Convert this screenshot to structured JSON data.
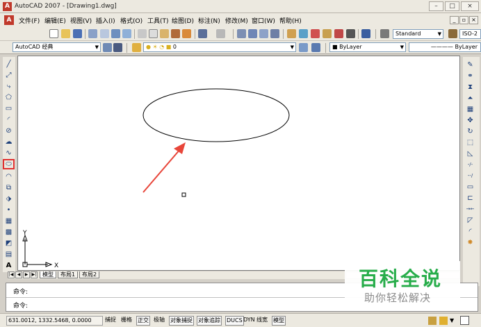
{
  "window": {
    "title": "AutoCAD 2007 - [Drawing1.dwg]",
    "app_icon": "A",
    "controls": {
      "minimize": "–",
      "maximize": "□",
      "close": "×"
    }
  },
  "menubar": {
    "doc_icon": "A",
    "items": [
      "文件(F)",
      "编辑(E)",
      "视图(V)",
      "插入(I)",
      "格式(O)",
      "工具(T)",
      "绘图(D)",
      "标注(N)",
      "修改(M)",
      "窗口(W)",
      "帮助(H)"
    ],
    "doc_controls": {
      "minimize": "_",
      "restore": "▫",
      "close": "×"
    }
  },
  "toolbar": {
    "text_style": "Standard",
    "dim_style": "ISO-2"
  },
  "toolbar2": {
    "workspace": "AutoCAD 经典",
    "layer": "0",
    "color": "ByLayer",
    "linetype": "ByLayer"
  },
  "colors": {
    "accent_highlight": "#e03030",
    "arrow": "#e8463a",
    "watermark_green": "#27ad4a",
    "watermark_gray": "#8a8a8a"
  },
  "left_tools": [
    {
      "name": "line-icon",
      "glyph": "╱"
    },
    {
      "name": "construction-line-icon",
      "glyph": "⤢"
    },
    {
      "name": "polyline-icon",
      "glyph": "⤷"
    },
    {
      "name": "polygon-icon",
      "glyph": "⬠"
    },
    {
      "name": "rectangle-icon",
      "glyph": "▭"
    },
    {
      "name": "arc-icon",
      "glyph": "◜"
    },
    {
      "name": "circle-icon",
      "glyph": "⊘"
    },
    {
      "name": "revision-cloud-icon",
      "glyph": "☁"
    },
    {
      "name": "spline-icon",
      "glyph": "∿"
    },
    {
      "name": "ellipse-icon",
      "glyph": "⬭",
      "selected": true
    },
    {
      "name": "ellipse-arc-icon",
      "glyph": "◠"
    },
    {
      "name": "insert-block-icon",
      "glyph": "⧉"
    },
    {
      "name": "make-block-icon",
      "glyph": "⬗"
    },
    {
      "name": "point-icon",
      "glyph": "•"
    },
    {
      "name": "hatch-icon",
      "glyph": "▦"
    },
    {
      "name": "gradient-icon",
      "glyph": "▩"
    },
    {
      "name": "region-icon",
      "glyph": "◩"
    },
    {
      "name": "table-icon",
      "glyph": "▤"
    },
    {
      "name": "multiline-text-icon",
      "glyph": "A"
    }
  ],
  "right_tools": [
    {
      "name": "erase-icon",
      "glyph": "✎"
    },
    {
      "name": "copy-icon",
      "glyph": "⚭"
    },
    {
      "name": "mirror-icon",
      "glyph": "⧗"
    },
    {
      "name": "offset-icon",
      "glyph": "⏶"
    },
    {
      "name": "array-icon",
      "glyph": "▦"
    },
    {
      "name": "move-icon",
      "glyph": "✥"
    },
    {
      "name": "rotate-icon",
      "glyph": "↻"
    },
    {
      "name": "scale-icon",
      "glyph": "⬚"
    },
    {
      "name": "stretch-icon",
      "glyph": "◺"
    },
    {
      "name": "trim-icon",
      "glyph": "-/-"
    },
    {
      "name": "extend-icon",
      "glyph": "--/"
    },
    {
      "name": "break-at-point-icon",
      "glyph": "▭"
    },
    {
      "name": "break-icon",
      "glyph": "⊏"
    },
    {
      "name": "join-icon",
      "glyph": "→←"
    },
    {
      "name": "chamfer-icon",
      "glyph": "◸"
    },
    {
      "name": "fillet-icon",
      "glyph": "◜"
    },
    {
      "name": "explode-icon",
      "glyph": "✸"
    }
  ],
  "canvas": {
    "ucs_y": "Y",
    "ucs_x": "X"
  },
  "tabs": {
    "nav": [
      "|◀",
      "◀",
      "▶",
      "▶|"
    ],
    "items": [
      {
        "label": "模型",
        "active": true
      },
      {
        "label": "布局1",
        "active": false
      },
      {
        "label": "布局2",
        "active": false
      }
    ]
  },
  "command": {
    "line1": "命令:",
    "line2": "命令:"
  },
  "statusbar": {
    "coords": "631.0012, 1332.5468, 0.0000",
    "toggles": [
      {
        "label": "捕捉",
        "on": false
      },
      {
        "label": "栅格",
        "on": false
      },
      {
        "label": "正交",
        "on": true
      },
      {
        "label": "极轴",
        "on": false
      },
      {
        "label": "对象捕捉",
        "on": true
      },
      {
        "label": "对象追踪",
        "on": true
      },
      {
        "label": "DUCS",
        "on": true
      },
      {
        "label": "DYN",
        "on": false
      },
      {
        "label": "线宽",
        "on": false
      },
      {
        "label": "模型",
        "on": true
      }
    ]
  },
  "watermark": {
    "main": "百科全说",
    "sub": "助你轻松解决"
  }
}
